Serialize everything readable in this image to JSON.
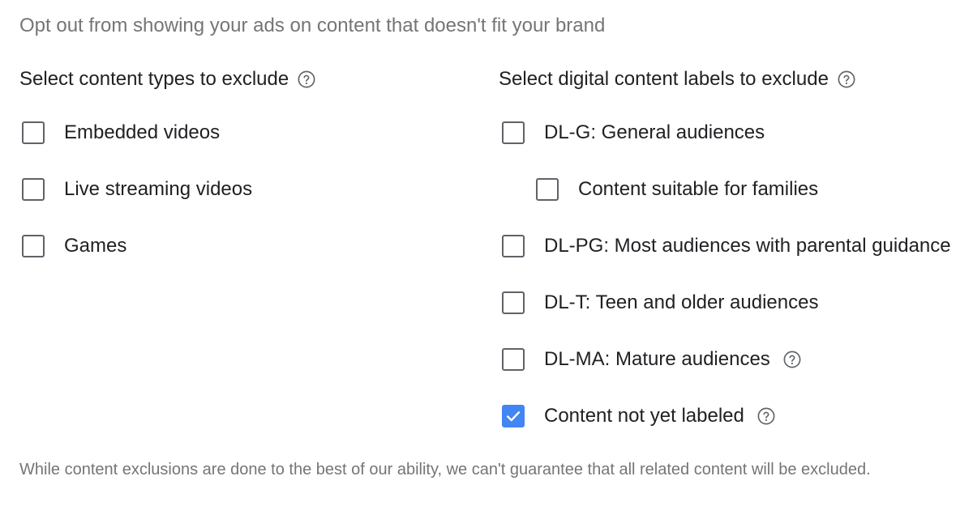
{
  "intro_text": "Opt out from showing your ads on content that doesn't fit your brand",
  "content_types": {
    "heading": "Select content types to exclude",
    "help_icon": "question-circle-icon",
    "options": [
      {
        "label": "Embedded videos",
        "checked": false
      },
      {
        "label": "Live streaming videos",
        "checked": false
      },
      {
        "label": "Games",
        "checked": false
      }
    ]
  },
  "content_labels": {
    "heading": "Select digital content labels to exclude",
    "help_icon": "question-circle-icon",
    "options": [
      {
        "label": "DL-G: General audiences",
        "checked": false,
        "indented": false,
        "has_help": false
      },
      {
        "label": "Content suitable for families",
        "checked": false,
        "indented": true,
        "has_help": false
      },
      {
        "label": "DL-PG: Most audiences with parental guidance",
        "checked": false,
        "indented": false,
        "has_help": false
      },
      {
        "label": "DL-T: Teen and older audiences",
        "checked": false,
        "indented": false,
        "has_help": false
      },
      {
        "label": "DL-MA: Mature audiences",
        "checked": false,
        "indented": false,
        "has_help": true
      },
      {
        "label": "Content not yet labeled",
        "checked": true,
        "indented": false,
        "has_help": true
      }
    ]
  },
  "footer_text": "While content exclusions are done to the best of our ability, we can't guarantee that all related content will be excluded.",
  "colors": {
    "checkbox_checked": "#4285f4",
    "checkbox_border": "#5f6368",
    "secondary_text": "#757575",
    "primary_text": "#202124"
  }
}
